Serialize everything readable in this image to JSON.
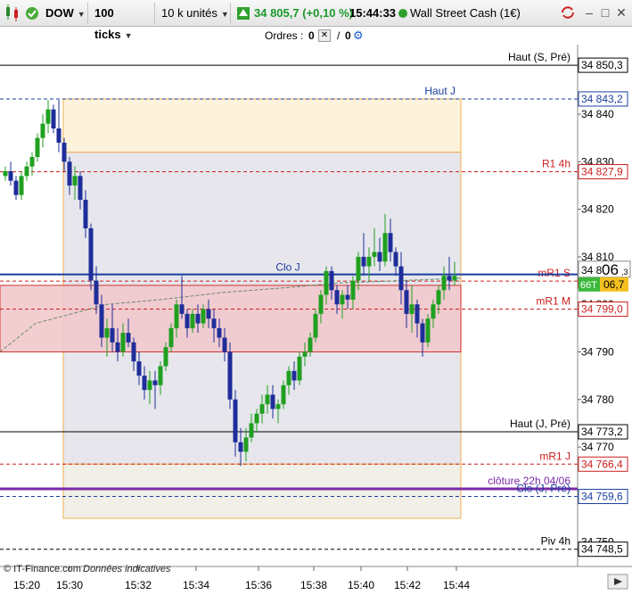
{
  "toolbar": {
    "symbol": "DOW",
    "ticks": "100 ticks",
    "units": "10 k unités",
    "price": "34 805,7",
    "change": "(+0,10 %)",
    "time": "15:44:33",
    "instrument": "Wall Street Cash (1€)"
  },
  "orders": {
    "label": "Ordres :",
    "count1": "0",
    "sep": "/",
    "count2": "0"
  },
  "levels": [
    {
      "label": "Haut (S, Pré)",
      "price": "34 850,3",
      "value": 34850.3,
      "color": "#000000",
      "style": "solid"
    },
    {
      "label": "Haut J",
      "price": "34 843,2",
      "value": 34843.2,
      "color": "#1a3fa0",
      "style": "dash"
    },
    {
      "label": "R1 4h",
      "price": "34 827,9",
      "value": 34827.9,
      "color": "#cc1f1f",
      "style": "dash"
    },
    {
      "label": "mR1 S",
      "price": "34 804,9",
      "value": 34804.9,
      "color": "#cc1f1f",
      "style": "dash"
    },
    {
      "label": "mR1 M",
      "price": "34 799,0",
      "value": 34799.0,
      "color": "#cc1f1f",
      "style": "dash"
    },
    {
      "label": "Haut (J, Pré)",
      "price": "34 773,2",
      "value": 34773.2,
      "color": "#000000",
      "style": "solid"
    },
    {
      "label": "mR1 J",
      "price": "34 766,4",
      "value": 34766.4,
      "color": "#cc1f1f",
      "style": "dash"
    },
    {
      "label": "clôture 22h 04/06",
      "price": "",
      "value": 34761.2,
      "color": "#7a2aa8",
      "style": "solid"
    },
    {
      "label": "Clo (J, Pré)",
      "price": "34 759,6",
      "value": 34759.6,
      "color": "#1a3fa0",
      "style": "dash"
    },
    {
      "label": "Piv 4h",
      "price": "34 748,5",
      "value": 34748.5,
      "color": "#000000",
      "style": "dash"
    }
  ],
  "clo_j": {
    "label": "Clo J",
    "value": 34806.3
  },
  "current": {
    "prefix": "34 8",
    "big": "06",
    "sub": ",3",
    "tag": "66T",
    "tag_price": "06,7"
  },
  "axis": {
    "y_ticks": [
      "34 840",
      "34 830",
      "34 820",
      "34 810",
      "34 800",
      "34 790",
      "34 780",
      "34 770",
      "34 760",
      "34 750"
    ],
    "x_ticks": [
      "15:20",
      "15:30",
      "15:32",
      "15:34",
      "15:36",
      "15:38",
      "15:40",
      "15:42",
      "15:44"
    ]
  },
  "footer": {
    "copyright": "© IT-Finance.com",
    "note": "Données indicatives"
  },
  "colors": {
    "up": "#20a020",
    "down": "#1e2d9a",
    "accent_up": "#1a9a2a"
  }
}
